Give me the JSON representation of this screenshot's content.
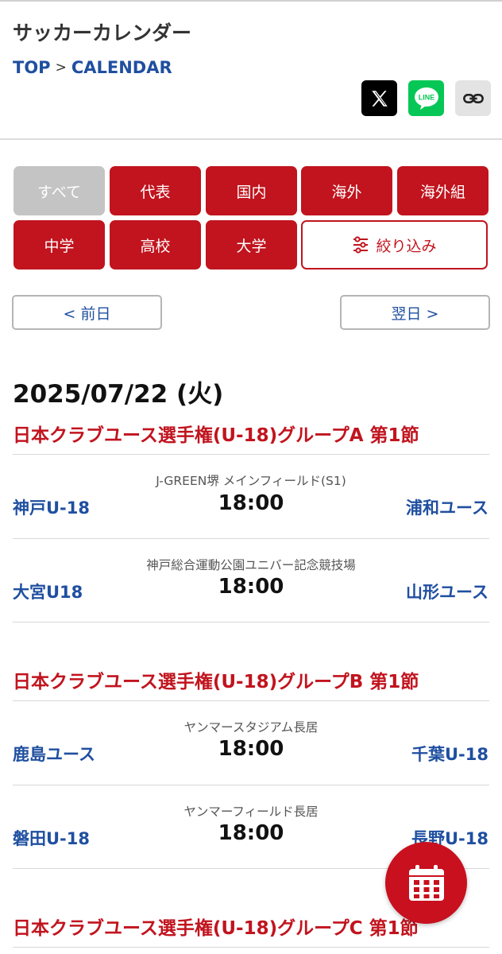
{
  "header": {
    "title": "サッカーカレンダー",
    "breadcrumb": {
      "home": "TOP",
      "separator": ">",
      "current": "CALENDAR"
    },
    "share": {
      "x_icon": "x-logo-icon",
      "line_label": "LINE",
      "link_icon": "link-icon"
    }
  },
  "filters": {
    "row1": [
      "すべて",
      "代表",
      "国内",
      "海外",
      "海外組"
    ],
    "row2": [
      "中学",
      "高校",
      "大学"
    ],
    "refine_label": "絞り込み",
    "active_index": 0
  },
  "date_nav": {
    "prev": "< 前日",
    "next": "翌日 >"
  },
  "date_heading": "2025/07/22 (火)",
  "competitions": [
    {
      "title": "日本クラブユース選手権(U-18)グループA 第1節",
      "matches": [
        {
          "venue": "J-GREEN堺 メインフィールド(S1)",
          "time": "18:00",
          "home": "神戸U-18",
          "away": "浦和ユース"
        },
        {
          "venue": "神戸総合運動公園ユニバー記念競技場",
          "time": "18:00",
          "home": "大宮U18",
          "away": "山形ユース"
        }
      ]
    },
    {
      "title": "日本クラブユース選手権(U-18)グループB 第1節",
      "matches": [
        {
          "venue": "ヤンマースタジアム長居",
          "time": "18:00",
          "home": "鹿島ユース",
          "away": "千葉U-18"
        },
        {
          "venue": "ヤンマーフィールド長居",
          "time": "18:00",
          "home": "磐田U-18",
          "away": "長野U-18"
        }
      ]
    },
    {
      "title": "日本クラブユース選手権(U-18)グループC 第1節",
      "matches": []
    }
  ],
  "fab": {
    "icon": "calendar-icon"
  },
  "colors": {
    "accent_red": "#c1141e",
    "link_blue": "#1f4fa0",
    "inactive_gray": "#c4c4c4",
    "line_green": "#06c755"
  }
}
